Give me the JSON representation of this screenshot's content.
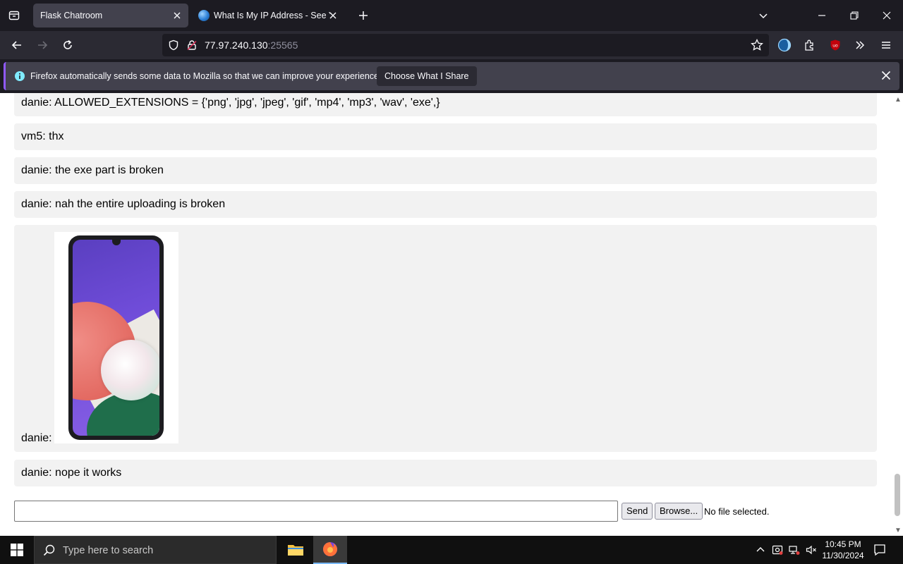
{
  "browser": {
    "tabs": [
      {
        "title": "Flask Chatroom",
        "active": true
      },
      {
        "title": "What Is My IP Address - See Your Public Address",
        "active": false
      }
    ],
    "url": {
      "host": "77.97.240.130",
      "port": ":25565"
    }
  },
  "notification": {
    "text": "Firefox automatically sends some data to Mozilla so that we can improve your experience.",
    "button_label": "Choose What I Share"
  },
  "chat": {
    "messages": [
      {
        "text": "danie: ALLOWED_EXTENSIONS = {'png', 'jpg', 'jpeg', 'gif', 'mp4', 'mp3', 'wav', 'exe',}"
      },
      {
        "text": "vm5: thx"
      },
      {
        "text": "danie: the exe part is broken"
      },
      {
        "text": "danie: nah the entire uploading is broken"
      },
      {
        "text": "danie:",
        "image": "smartphone-photo"
      },
      {
        "text": "danie: nope it works"
      }
    ],
    "composer": {
      "input_value": "",
      "send_label": "Send",
      "browse_label": "Browse...",
      "file_status": "No file selected."
    }
  },
  "taskbar": {
    "search_placeholder": "Type here to search",
    "time": "10:45 PM",
    "date": "11/30/2024"
  },
  "colors": {
    "accent": "#9059ff",
    "page_bg": "#ffffff",
    "message_bg": "#f2f2f2"
  }
}
